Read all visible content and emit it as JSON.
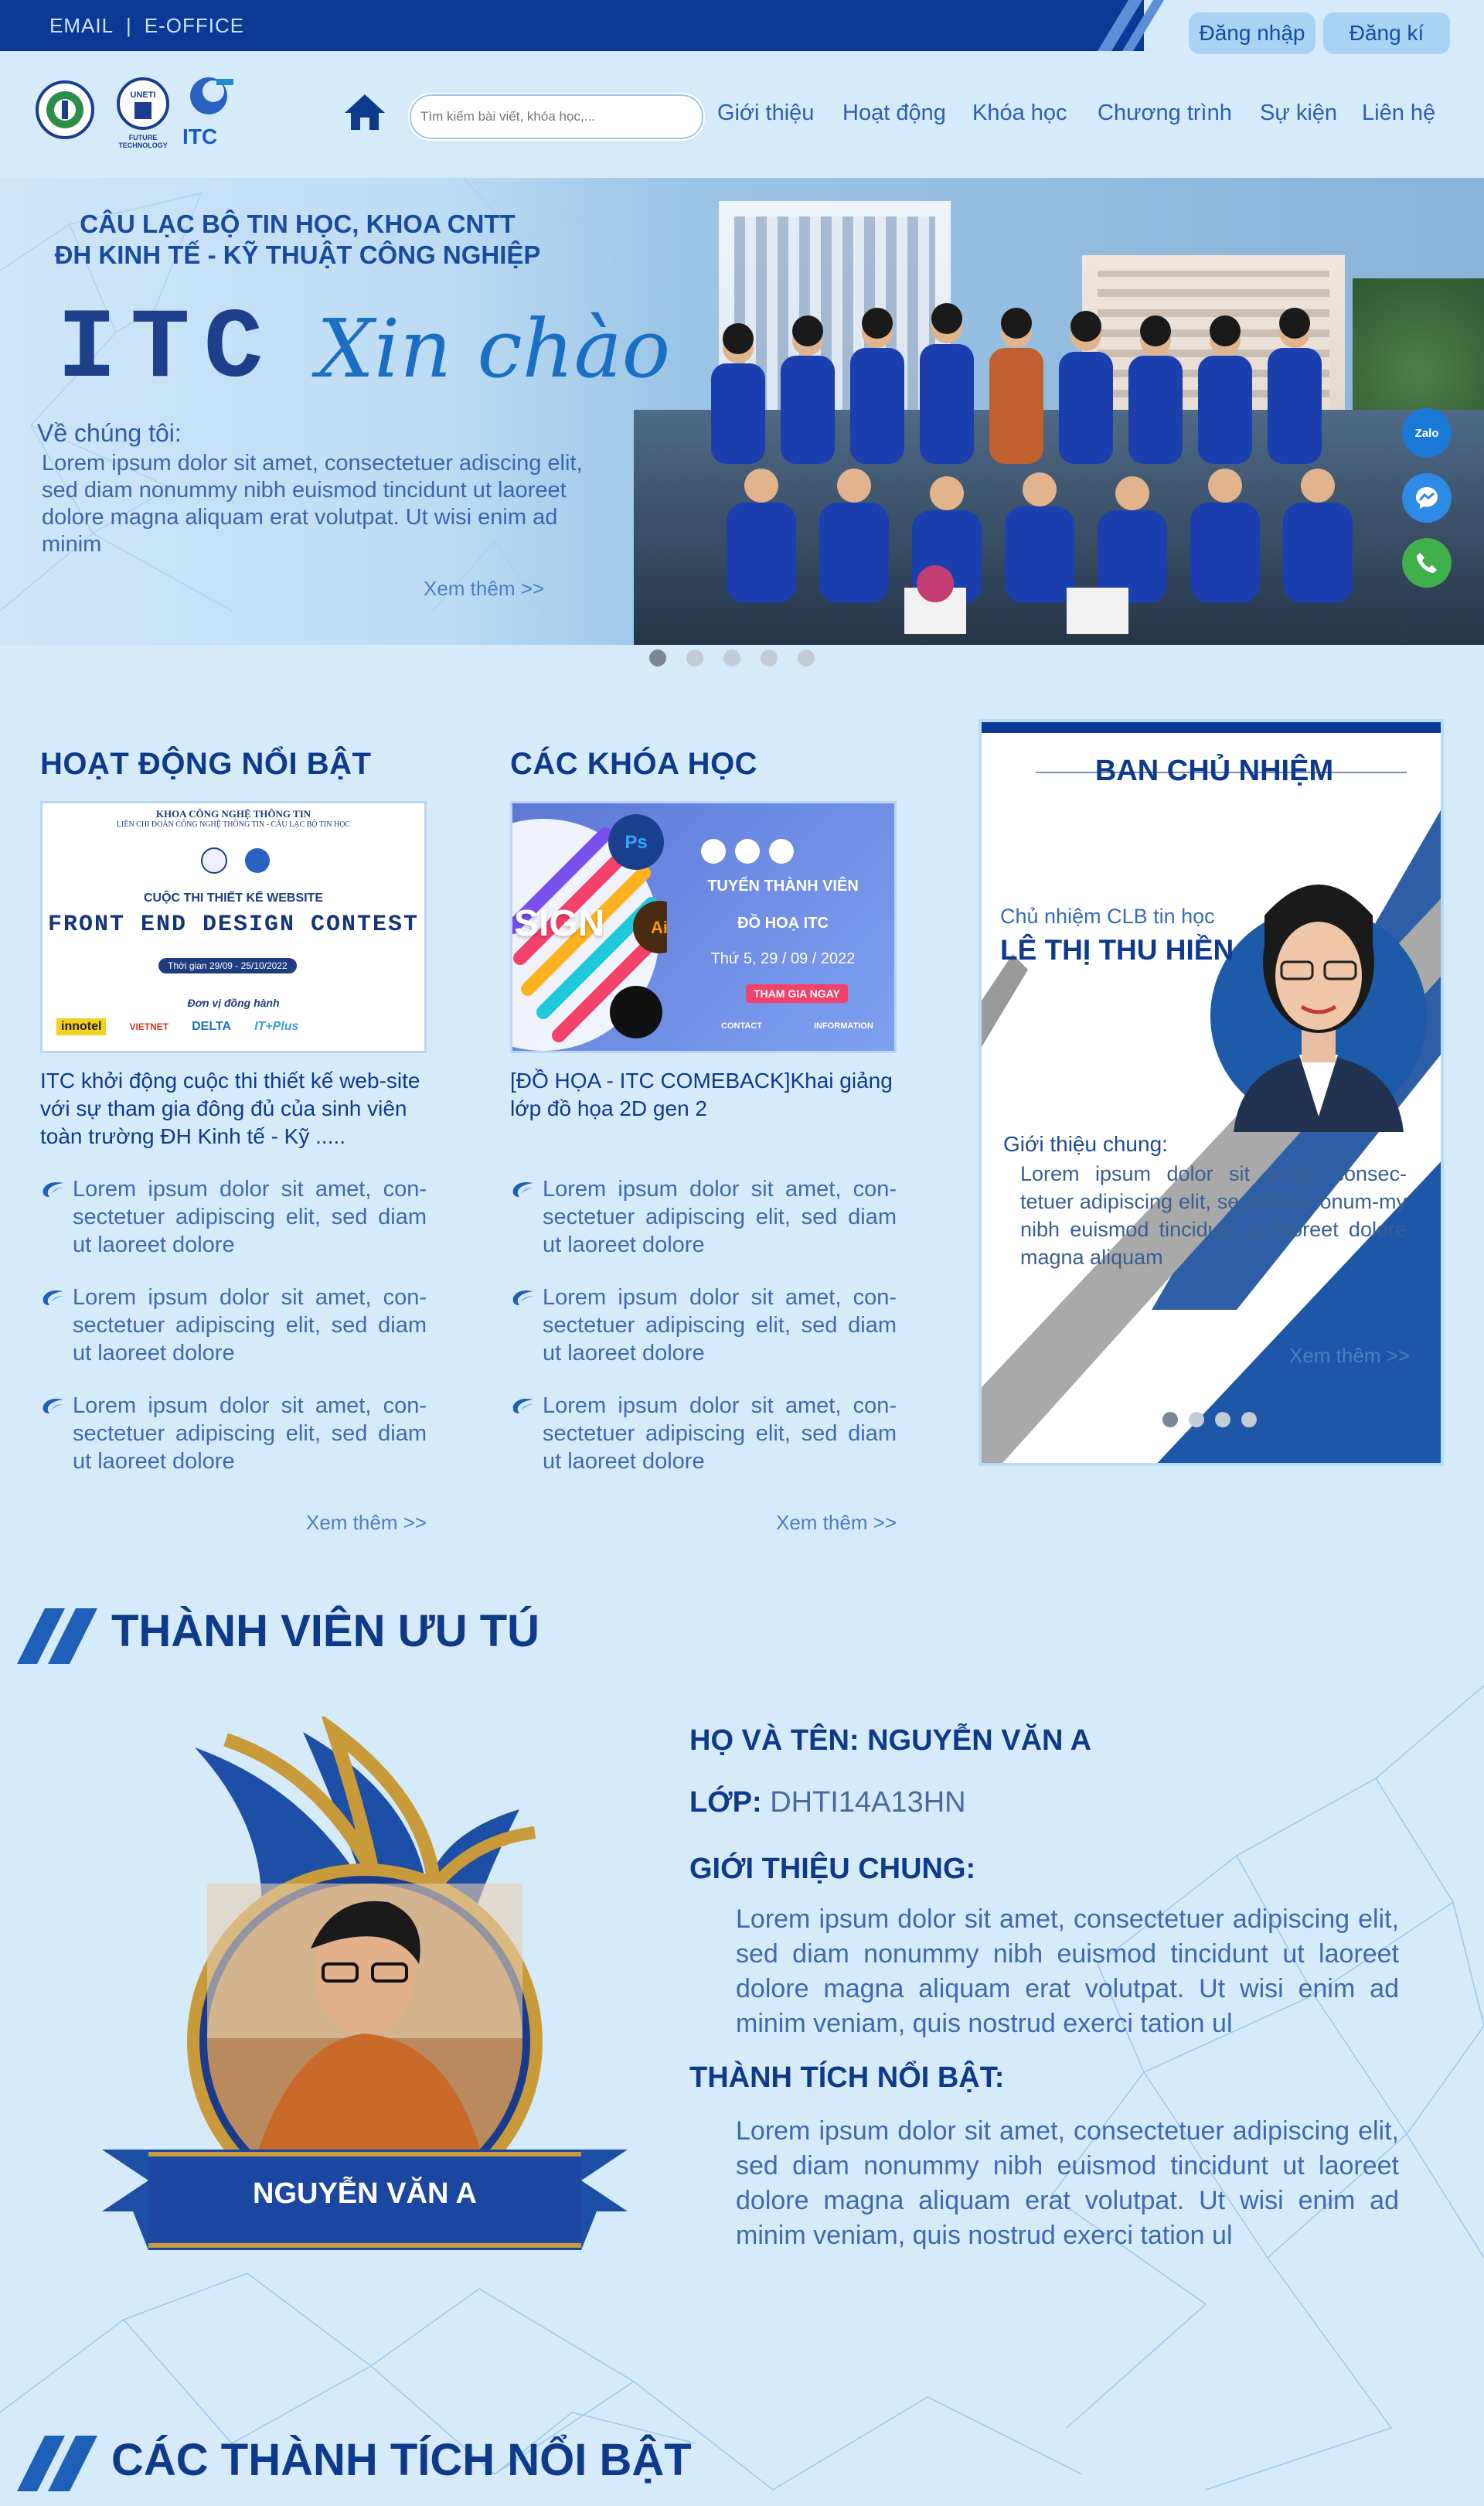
{
  "topbar": {
    "email": "EMAIL",
    "separator": "|",
    "eoffice": "E-OFFICE",
    "login": "Đăng nhập",
    "register": "Đăng kí"
  },
  "header": {
    "logos": [
      "UNETI",
      "FUTURE TECHNOLOGY",
      "ITC"
    ],
    "search_placeholder": "Tìm kiếm bài viết, khóa học,...",
    "nav": [
      "Giới thiệu",
      "Hoạt động",
      "Khóa học",
      "Chương trình",
      "Sự kiện",
      "Liên hệ"
    ]
  },
  "hero": {
    "line1": "CÂU LẠC BỘ TIN HỌC, KHOA CNTT",
    "line2": "ĐH KINH TẾ - KỸ THUẬT CÔNG NGHIỆP",
    "brand": "ITC",
    "greeting": "Xin chào",
    "about_label": "Về chúng tôi:",
    "about_text": "Lorem ipsum dolor sit amet, consectetuer adiscing elit, sed diam nonummy nibh euismod tincidunt ut laoreet dolore magna aliquam erat volutpat. Ut wisi enim ad minim",
    "more": "Xem thêm >>",
    "slides": 5,
    "active_slide": 1
  },
  "floating": {
    "zalo": "Zalo"
  },
  "activities": {
    "title": "HOẠT ĐỘNG NỔI BẬT",
    "poster": {
      "org1": "KHOA CÔNG NGHỆ THÔNG TIN",
      "org2": "LIÊN CHI ĐOÀN CÔNG NGHỆ THÔNG TIN - CÂU LẠC BỘ TIN HỌC",
      "sub": "CUỘC THI THIẾT KẾ WEBSITE",
      "main": "FRONT END DESIGN CONTEST",
      "time": "Thời gian 29/09 - 25/10/2022",
      "sponsors_label": "Đơn vị đồng hành",
      "sponsors": [
        "innotel",
        "VIETNET",
        "DELTA",
        "IT+Plus"
      ]
    },
    "caption": "ITC khởi động cuộc thi thiết kế web-site với sự tham gia đông đủ của sinh viên toàn trường ĐH Kinh tế - Kỹ .....",
    "bullets": [
      "Lorem ipsum dolor sit amet, con-sectetuer adipiscing elit, sed diam ut laoreet dolore",
      "Lorem ipsum dolor sit amet, con-sectetuer adipiscing elit, sed diam ut laoreet dolore",
      "Lorem ipsum dolor sit amet, con-sectetuer adipiscing elit, sed diam ut laoreet dolore"
    ],
    "more": "Xem thêm >>"
  },
  "courses": {
    "title": "CÁC KHÓA HỌC",
    "poster": {
      "left": "SIGN",
      "l1": "TUYỂN THÀNH VIÊN",
      "l2": "ĐỒ HOẠ ITC",
      "date": "Thứ 5, 29 / 09 / 2022",
      "cta": "THAM GIA NGAY",
      "contact": "CONTACT",
      "info": "INFORMATION"
    },
    "caption": "[ĐỒ HỌA - ITC COMEBACK]Khai giảng lớp đồ họa 2D gen 2",
    "bullets": [
      "Lorem ipsum dolor sit amet, con-sectetuer adipiscing elit, sed diam ut laoreet dolore",
      "Lorem ipsum dolor sit amet, con-sectetuer adipiscing elit, sed diam ut laoreet dolore",
      "Lorem ipsum dolor sit amet, con-sectetuer adipiscing elit, sed diam ut laoreet dolore"
    ],
    "more": "Xem thêm >>"
  },
  "board": {
    "title": "BAN CHỦ NHIỆM",
    "role": "Chủ nhiệm CLB tin học",
    "name": "LÊ THỊ THU HIỀN",
    "intro_label": "Giới thiệu chung:",
    "intro_text": "Lorem ipsum dolor sit amet, consec-tetuer adipiscing elit, sed diam nonum-my nibh euismod tincidunt ut laoreet dolore magna aliquam",
    "more": "Xem thêm >>",
    "slides": 4
  },
  "member": {
    "section_title": "THÀNH VIÊN ƯU TÚ",
    "banner_name": "NGUYỄN VĂN A",
    "name_label": "HỌ VÀ TÊN: NGUYỄN VĂN A",
    "class_label": "LỚP:",
    "class_value": "DHTI14A13HN",
    "intro_label": "GIỚI THIỆU CHUNG:",
    "intro_text": "Lorem ipsum dolor sit amet, consectetuer adipiscing elit, sed diam nonummy nibh euismod tincidunt ut laoreet dolore magna aliquam erat volutpat. Ut wisi enim ad minim veniam, quis nostrud exerci tation ul",
    "achieve_label": "THÀNH TÍCH NỔI BẬT:",
    "achieve_text": "Lorem ipsum dolor sit amet, consectetuer adipiscing elit, sed diam nonummy nibh euismod tincidunt ut laoreet dolore magna aliquam erat volutpat. Ut wisi enim ad minim veniam, quis nostrud exerci tation ul"
  },
  "achievements": {
    "section_title": "CÁC THÀNH TÍCH NỔI BẬT"
  },
  "colors": {
    "primary": "#0e3a8c",
    "topbar": "#0b3a96",
    "bg": "#d6ebf9",
    "button": "#a9d2f3"
  }
}
